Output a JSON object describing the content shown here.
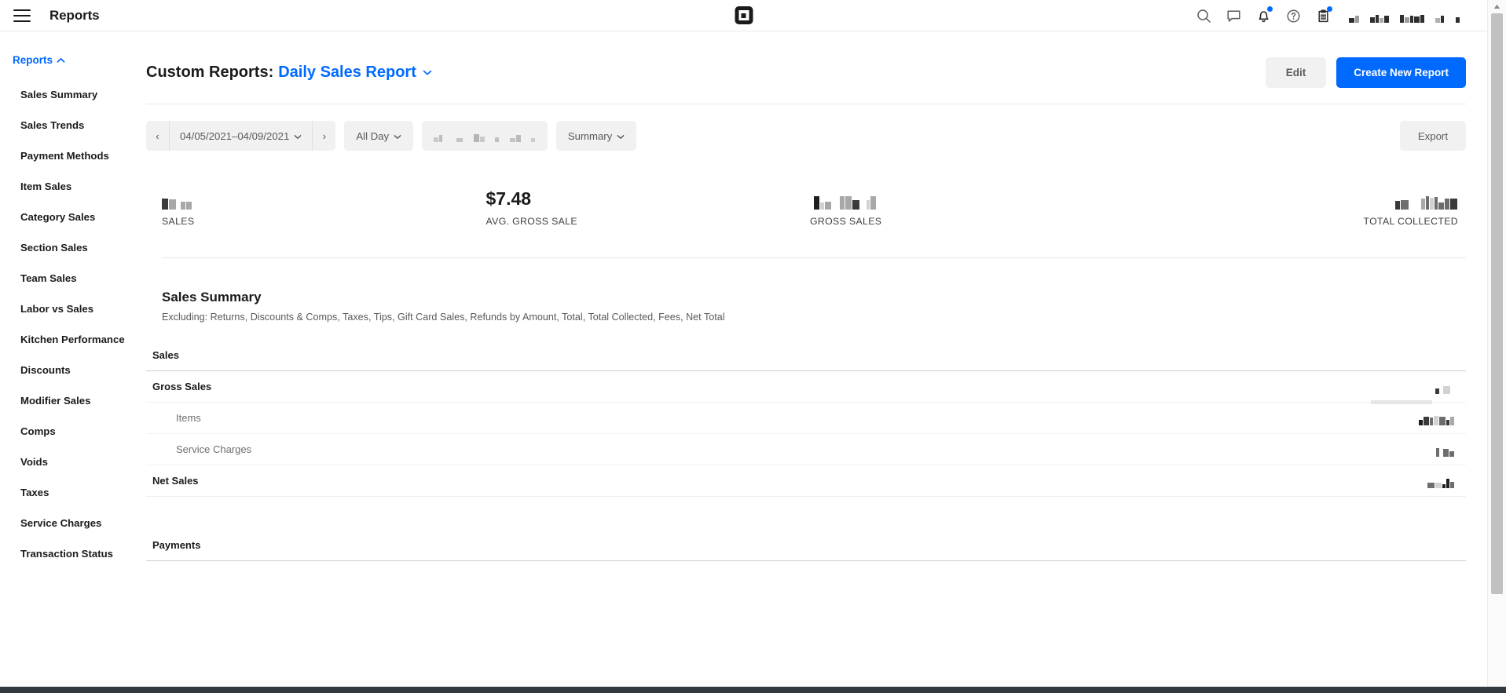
{
  "topbar": {
    "title": "Reports",
    "menu_icon": "hamburger-icon",
    "logo": "square-logo",
    "icons": [
      {
        "name": "search-icon",
        "badge": false
      },
      {
        "name": "message-icon",
        "badge": false
      },
      {
        "name": "bell-icon",
        "badge": true
      },
      {
        "name": "help-circle-icon",
        "badge": false
      },
      {
        "name": "clipboard-icon",
        "badge": true
      }
    ],
    "account_name": "[redacted]"
  },
  "sidebar": {
    "header": {
      "label": "Reports",
      "chevron": "chevron-up-icon",
      "expanded": true
    },
    "items": [
      {
        "label": "Sales Summary"
      },
      {
        "label": "Sales Trends"
      },
      {
        "label": "Payment Methods"
      },
      {
        "label": "Item Sales"
      },
      {
        "label": "Category Sales"
      },
      {
        "label": "Section Sales"
      },
      {
        "label": "Team Sales"
      },
      {
        "label": "Labor vs Sales"
      },
      {
        "label": "Kitchen Performance"
      },
      {
        "label": "Discounts"
      },
      {
        "label": "Modifier Sales"
      },
      {
        "label": "Comps"
      },
      {
        "label": "Voids"
      },
      {
        "label": "Taxes"
      },
      {
        "label": "Service Charges"
      },
      {
        "label": "Transaction Status"
      }
    ]
  },
  "page": {
    "title_prefix": "Custom Reports:",
    "report_name": "Daily Sales Report",
    "report_chevron": "chevron-down-icon",
    "edit_label": "Edit",
    "create_label": "Create New Report"
  },
  "filters": {
    "prev_label": "‹",
    "next_label": "›",
    "date_range": "04/05/2021–04/09/2021",
    "time_of_day": "All Day",
    "location_filter": "[redacted]",
    "view_mode": "Summary",
    "export_label": "Export"
  },
  "kpis": [
    {
      "label": "SALES",
      "value": "[redacted]",
      "redacted": true
    },
    {
      "label": "AVG. GROSS SALE",
      "value": "$7.48",
      "redacted": false
    },
    {
      "label": "GROSS SALES",
      "value": "[redacted]",
      "redacted": true
    },
    {
      "label": "TOTAL COLLECTED",
      "value": "[redacted]",
      "redacted": true
    }
  ],
  "summary": {
    "title": "Sales Summary",
    "subtitle": "Excluding: Returns, Discounts & Comps, Taxes, Tips, Gift Card Sales, Refunds by Amount, Total, Total Collected, Fees, Net Total"
  },
  "table": {
    "rows": [
      {
        "label": "Sales",
        "kind": "section-head",
        "value": "",
        "redacted": false
      },
      {
        "label": "Gross Sales",
        "kind": "group-head",
        "value": "[redacted]",
        "redacted": true
      },
      {
        "label": "Items",
        "kind": "sub",
        "value": "[redacted]",
        "redacted": true
      },
      {
        "label": "Service Charges",
        "kind": "sub",
        "value": "[redacted]",
        "redacted": true
      },
      {
        "label": "Net Sales",
        "kind": "group-head",
        "value": "[redacted]",
        "redacted": true
      },
      {
        "label": "",
        "kind": "spacer",
        "value": "",
        "redacted": false
      },
      {
        "label": "Payments",
        "kind": "section-head",
        "value": "",
        "redacted": false
      }
    ]
  },
  "colors": {
    "accent": "#006aff",
    "text": "#1b1b1b",
    "muted": "#6e6e6e",
    "pill_bg": "#f1f1f1",
    "border": "#e8e8e8",
    "footer": "#333a3f"
  },
  "scrollbar": {
    "position": "right",
    "thumb_visible": true
  }
}
